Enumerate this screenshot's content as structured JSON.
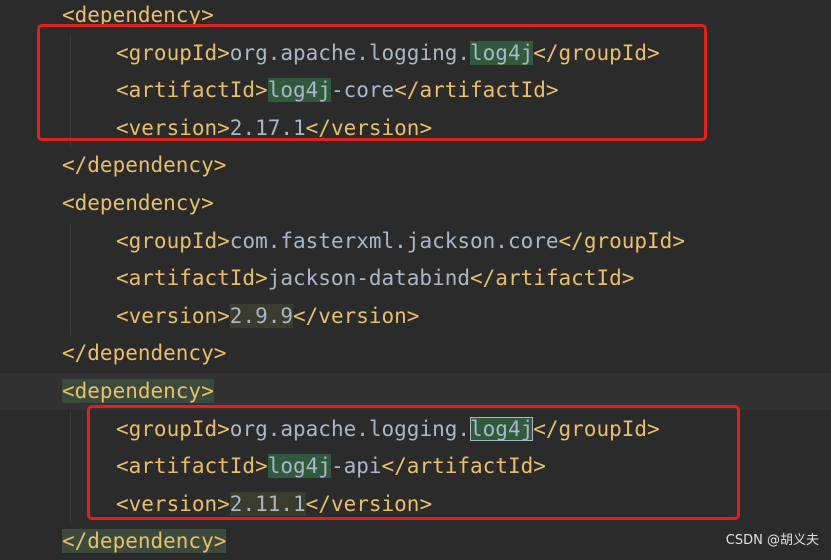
{
  "colors": {
    "background": "#2b2b2b",
    "tag": "#e8bf6a",
    "text": "#a9b7c6",
    "search_highlight": "#32593d",
    "annotation_box": "#e0201d"
  },
  "lines": [
    {
      "indent": 1,
      "segments": [
        {
          "t": "<dependency>",
          "c": "tag"
        }
      ]
    },
    {
      "indent": 2,
      "segments": [
        {
          "t": "<groupId>",
          "c": "tag"
        },
        {
          "t": "org.apache.logging.",
          "c": "txt"
        },
        {
          "t": "log4j",
          "c": "txt",
          "h": "green"
        },
        {
          "t": "</groupId>",
          "c": "tag"
        }
      ]
    },
    {
      "indent": 2,
      "segments": [
        {
          "t": "<artifactId>",
          "c": "tag"
        },
        {
          "t": "log4j",
          "c": "txt",
          "h": "green"
        },
        {
          "t": "-core",
          "c": "txt"
        },
        {
          "t": "</artifactId>",
          "c": "tag"
        }
      ]
    },
    {
      "indent": 2,
      "segments": [
        {
          "t": "<version>",
          "c": "tag"
        },
        {
          "t": "2.17.1",
          "c": "txt"
        },
        {
          "t": "</version>",
          "c": "tag"
        }
      ]
    },
    {
      "indent": 1,
      "segments": [
        {
          "t": "</dependency>",
          "c": "tag"
        }
      ]
    },
    {
      "indent": 1,
      "segments": [
        {
          "t": "<dependency>",
          "c": "tag"
        }
      ]
    },
    {
      "indent": 2,
      "segments": [
        {
          "t": "<groupId>",
          "c": "tag"
        },
        {
          "t": "com.fasterxml.jackson.core",
          "c": "txt"
        },
        {
          "t": "</groupId>",
          "c": "tag"
        }
      ]
    },
    {
      "indent": 2,
      "segments": [
        {
          "t": "<artifactId>",
          "c": "tag"
        },
        {
          "t": "jackson-databind",
          "c": "txt"
        },
        {
          "t": "</artifactId>",
          "c": "tag"
        }
      ]
    },
    {
      "indent": 2,
      "segments": [
        {
          "t": "<version>",
          "c": "tag"
        },
        {
          "t": "2.9.9",
          "c": "txt",
          "h": "olive"
        },
        {
          "t": "</version>",
          "c": "tag"
        }
      ]
    },
    {
      "indent": 1,
      "segments": [
        {
          "t": "</dependency>",
          "c": "tag"
        }
      ]
    },
    {
      "indent": 1,
      "current": true,
      "segments": [
        {
          "t": "<dependency>",
          "c": "tag",
          "h": "tag"
        }
      ]
    },
    {
      "indent": 2,
      "segments": [
        {
          "t": "<groupId>",
          "c": "tag"
        },
        {
          "t": "org.apache.logging.",
          "c": "txt"
        },
        {
          "t": "log4j",
          "c": "txt",
          "h": "green-box"
        },
        {
          "t": "</groupId>",
          "c": "tag"
        }
      ]
    },
    {
      "indent": 2,
      "segments": [
        {
          "t": "<artifactId>",
          "c": "tag"
        },
        {
          "t": "log4j",
          "c": "txt",
          "h": "green"
        },
        {
          "t": "-api",
          "c": "txt"
        },
        {
          "t": "</artifactId>",
          "c": "tag"
        }
      ]
    },
    {
      "indent": 2,
      "segments": [
        {
          "t": "<version>",
          "c": "tag"
        },
        {
          "t": "2.11.1",
          "c": "txt",
          "h": "olive"
        },
        {
          "t": "</version>",
          "c": "tag"
        }
      ]
    },
    {
      "indent": 1,
      "segments": [
        {
          "t": "</dependency>",
          "c": "tag",
          "h": "tag"
        }
      ]
    }
  ],
  "watermark": "CSDN @胡义夫"
}
